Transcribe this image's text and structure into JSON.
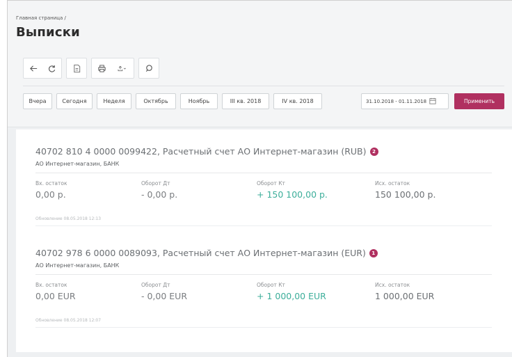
{
  "breadcrumb": "Главная страница /",
  "title": "Выписки",
  "toolbar": {
    "icons": [
      "arrow-left-icon",
      "refresh-icon",
      "document-icon",
      "print-icon",
      "export-icon",
      "search-icon"
    ]
  },
  "periods": [
    "Вчера",
    "Сегодня",
    "Неделя",
    "Октябрь",
    "Ноябрь",
    "III кв. 2018",
    "IV кв. 2018"
  ],
  "date_range": "31.10.2018 - 01.11.2018",
  "apply_label": "Применить",
  "accent_color": "#b03060",
  "credit_color": "#3cae9a",
  "labels": {
    "opening": "Вх. остаток",
    "debit": "Оборот Дт",
    "credit": "Оборот Кт",
    "closing": "Исх. остаток"
  },
  "accounts": [
    {
      "title": "40702 810 4 0000 0099422, Расчетный счет АО Интернет-магазин (RUB)",
      "badge": "2",
      "subtitle": "АО Интернет-магазин, БАНК",
      "opening": "0,00 р.",
      "debit": "- 0,00 р.",
      "credit": "+ 150 100,00 р.",
      "closing": "150 100,00 р.",
      "updated": "Обновление 08.05.2018 12:13"
    },
    {
      "title": "40702 978 6 0000 0089093, Расчетный счет АО Интернет-магазин (EUR)",
      "badge": "1",
      "subtitle": "АО Интернет-магазин, БАНК",
      "opening": "0,00 EUR",
      "debit": "- 0,00 EUR",
      "credit": "+ 1 000,00 EUR",
      "closing": "1 000,00 EUR",
      "updated": "Обновление 08.05.2018 12:07"
    }
  ]
}
